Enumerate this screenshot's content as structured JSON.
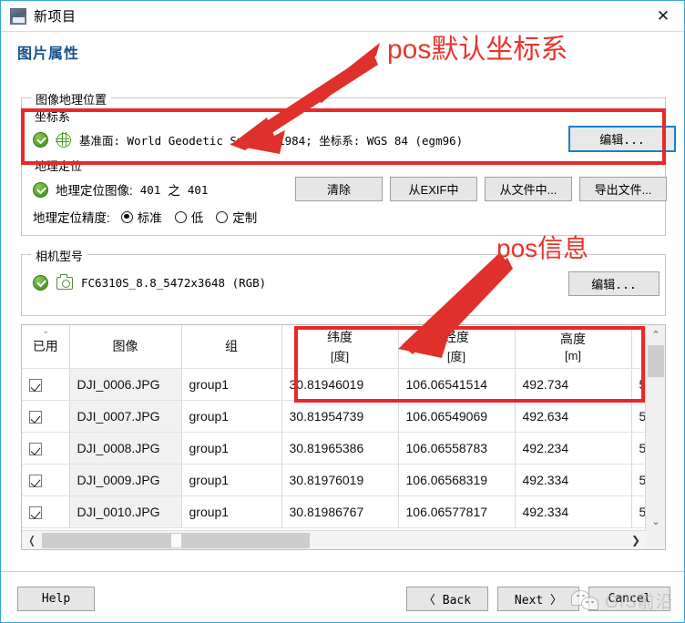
{
  "window": {
    "title": "新项目",
    "close_label": "✕",
    "icon": "app-icon"
  },
  "page": {
    "heading": "图片属性"
  },
  "geolocation_group": {
    "legend": "图像地理位置",
    "coordinate_system": {
      "legend": "坐标系",
      "status_icon": "green-check-icon",
      "globe_icon": "globe-icon",
      "value": "基准面: World Geodetic System 1984; 坐标系: WGS 84 (egm96)",
      "edit_button": "编辑..."
    },
    "geotag": {
      "legend": "地理定位",
      "status_icon": "green-check-icon",
      "images_label": "地理定位图像:",
      "images_count": "401",
      "images_of": "之",
      "images_total": "401",
      "buttons": [
        "清除",
        "从EXIF中",
        "从文件中...",
        "导出文件..."
      ],
      "accuracy_label": "地理定位精度:",
      "accuracy_options": [
        {
          "label": "标准",
          "selected": true
        },
        {
          "label": "低",
          "selected": false
        },
        {
          "label": "定制",
          "selected": false
        }
      ]
    }
  },
  "camera_group": {
    "legend": "相机型号",
    "status_icon": "green-check-icon",
    "camera_icon": "camera-icon",
    "model": "FC6310S_8.8_5472x3648 (RGB)",
    "edit_button": "编辑..."
  },
  "table": {
    "columns": [
      {
        "h1": "已用",
        "h2": ""
      },
      {
        "h1": "图像",
        "h2": ""
      },
      {
        "h1": "组",
        "h2": ""
      },
      {
        "h1": "纬度",
        "h2": "[度]"
      },
      {
        "h1": "经度",
        "h2": "[度]"
      },
      {
        "h1": "高度",
        "h2": "[m]"
      },
      {
        "h1": "",
        "h2": ""
      }
    ],
    "rows": [
      {
        "used": true,
        "image": "DJI_0006.JPG",
        "group": "group1",
        "lat": "30.81946019",
        "lon": "106.06541514",
        "alt": "492.734",
        "extra": "5"
      },
      {
        "used": true,
        "image": "DJI_0007.JPG",
        "group": "group1",
        "lat": "30.81954739",
        "lon": "106.06549069",
        "alt": "492.634",
        "extra": "5"
      },
      {
        "used": true,
        "image": "DJI_0008.JPG",
        "group": "group1",
        "lat": "30.81965386",
        "lon": "106.06558783",
        "alt": "492.234",
        "extra": "5"
      },
      {
        "used": true,
        "image": "DJI_0009.JPG",
        "group": "group1",
        "lat": "30.81976019",
        "lon": "106.06568319",
        "alt": "492.334",
        "extra": "5"
      },
      {
        "used": true,
        "image": "DJI_0010.JPG",
        "group": "group1",
        "lat": "30.81986767",
        "lon": "106.06577817",
        "alt": "492.334",
        "extra": "5"
      }
    ],
    "scroll_up": "⌃",
    "scroll_down": "⌄",
    "scroll_left": "❬",
    "scroll_right": "❯",
    "sort_chevron": "⌄"
  },
  "footer": {
    "help": "Help",
    "back": "〈 Back",
    "next": "Next 〉",
    "cancel": "Cancel"
  },
  "annotations": {
    "color": "#e8352c",
    "coord_label": "pos默认坐标系",
    "pos_label": "pos信息"
  },
  "watermark": {
    "text": "GIS前沿",
    "icon": "wechat-icon"
  }
}
